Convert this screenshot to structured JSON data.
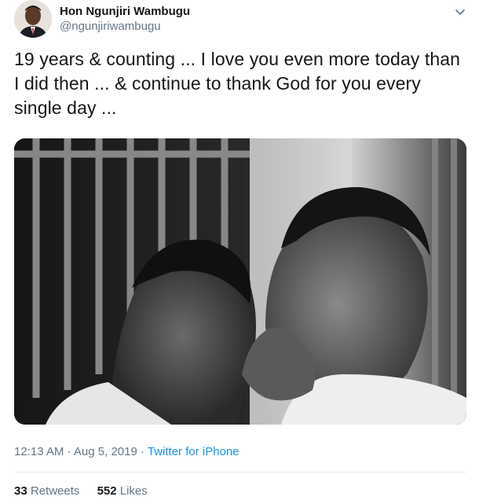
{
  "author": {
    "name": "Hon Ngunjiri Wambugu",
    "handle": "@ngunjiriwambugu"
  },
  "tweet": {
    "text": "19 years & counting ... I love you even more today than I did then ... & continue to thank God for you every single day ..."
  },
  "meta": {
    "time": "12:13 AM",
    "separator1": " · ",
    "date": "Aug 5, 2019",
    "separator2": " · ",
    "source": "Twitter for iPhone"
  },
  "stats": {
    "retweets_count": "33",
    "retweets_label": " Retweets",
    "likes_count": "552",
    "likes_label": " Likes"
  },
  "icons": {
    "caret": "chevron-down-icon"
  },
  "colors": {
    "text": "#14171a",
    "secondary": "#657786",
    "link": "#1b95e0",
    "divider": "#e6ecf0"
  }
}
